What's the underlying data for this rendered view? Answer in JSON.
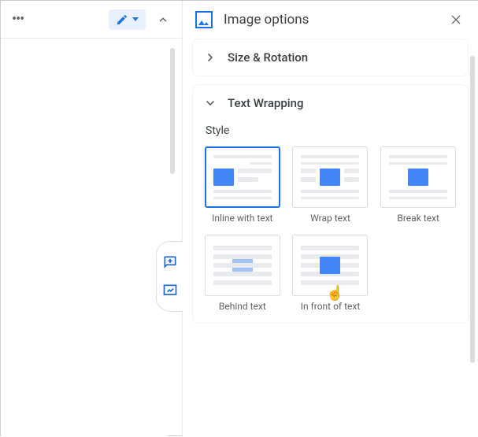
{
  "panel": {
    "title": "Image options",
    "sections": {
      "size_rotation": {
        "title": "Size & Rotation",
        "expanded": false
      },
      "text_wrapping": {
        "title": "Text Wrapping",
        "expanded": true,
        "style_label": "Style",
        "options": [
          {
            "id": "inline",
            "label": "Inline with text",
            "selected": true
          },
          {
            "id": "wrap",
            "label": "Wrap text",
            "selected": false
          },
          {
            "id": "break",
            "label": "Break text",
            "selected": false
          },
          {
            "id": "behind",
            "label": "Behind text",
            "selected": false
          },
          {
            "id": "infront",
            "label": "In front of text",
            "selected": false
          }
        ]
      }
    }
  },
  "icons": {
    "more": "more-horizontal-icon",
    "edit": "pencil-icon",
    "collapse": "chevron-up-icon",
    "image": "image-icon",
    "close": "close-icon",
    "right": "chevron-right-icon",
    "down": "chevron-down-icon",
    "add_comment": "add-comment-icon",
    "suggest": "suggest-edits-icon"
  }
}
